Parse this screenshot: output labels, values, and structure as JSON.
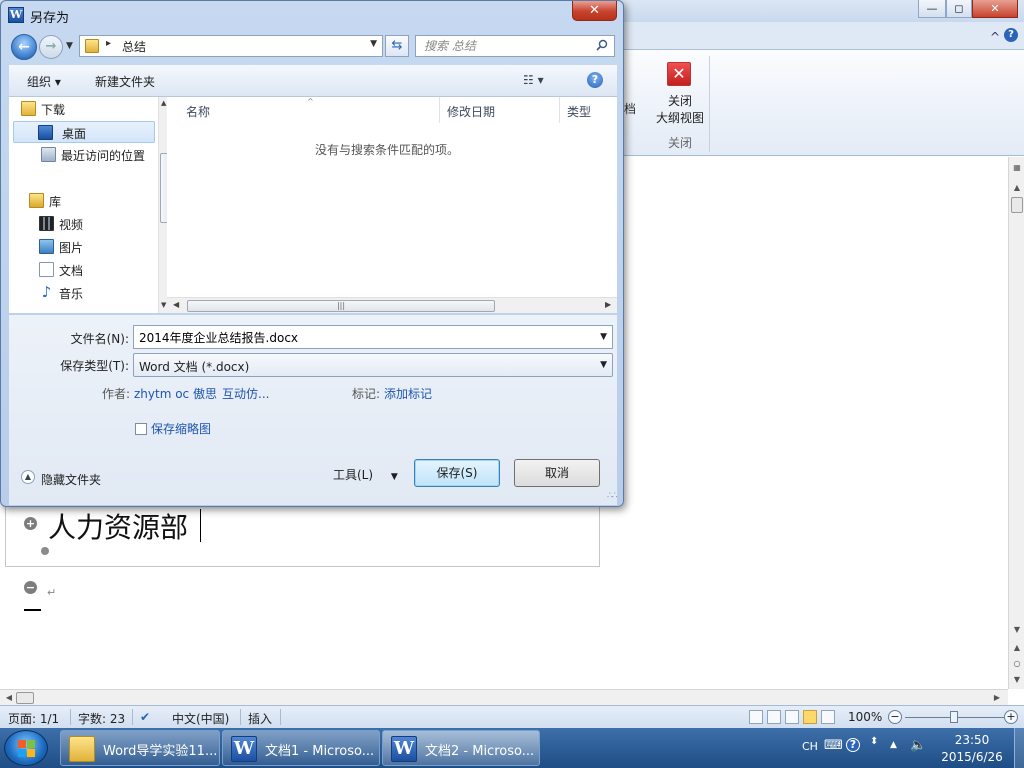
{
  "word": {
    "window_controls": {
      "minimize": "—",
      "maximize": "◻",
      "close": "✕"
    },
    "ribbon": {
      "partial_label": "档",
      "close_outline_label_line1": "关闭",
      "close_outline_label_line2": "大纲视图",
      "close_group_label": "关闭",
      "collapse_ribbon": "^",
      "help": "?"
    },
    "document": {
      "heading": "人力资源部",
      "expand_symbol": "+",
      "collapse_symbol": "−",
      "paragraph_mark": "↵"
    },
    "status": {
      "page": "页面: 1/1",
      "words": "字数: 23",
      "language": "中文(中国)",
      "insert_mode": "插入",
      "zoom": "100%",
      "zoom_level_percent": 100,
      "zoom_out": "−",
      "zoom_in": "+"
    }
  },
  "dialog": {
    "title": "另存为",
    "close_symbol": "✕",
    "address": {
      "path": "总结",
      "separator": "▸"
    },
    "search_placeholder": "搜索 总结",
    "toolbar": {
      "organize": "组织 ▾",
      "new_folder": "新建文件夹",
      "view": "☷ ▾",
      "help": "?"
    },
    "nav_items": [
      {
        "label": "下载",
        "icon": "download-folder-icon"
      },
      {
        "label": "桌面",
        "icon": "desktop-icon"
      },
      {
        "label": "最近访问的位置",
        "icon": "recent-places-icon"
      },
      {
        "label": "库",
        "icon": "library-icon"
      },
      {
        "label": "视频",
        "icon": "video-icon"
      },
      {
        "label": "图片",
        "icon": "pictures-icon"
      },
      {
        "label": "文档",
        "icon": "documents-icon"
      },
      {
        "label": "音乐",
        "icon": "music-icon"
      }
    ],
    "columns": [
      "名称",
      "修改日期",
      "类型"
    ],
    "empty_message": "没有与搜索条件匹配的项。",
    "form": {
      "filename_label": "文件名(N):",
      "filename_value": "2014年度企业总结报告.docx",
      "filetype_label": "保存类型(T):",
      "filetype_value": "Word 文档 (*.docx)",
      "author_label": "作者:",
      "author_value": "zhytm oc 傲思",
      "author_more": "互动仿...",
      "tags_label": "标记:",
      "tags_value": "添加标记",
      "thumbnail_label": "保存缩略图",
      "hide_folders": "隐藏文件夹",
      "tools": "工具(L)",
      "save": "保存(S)",
      "cancel": "取消"
    }
  },
  "taskbar": {
    "tasks": [
      {
        "label": "Word导学实验11...",
        "icon": "folder-icon"
      },
      {
        "label": "文档1 - Microso...",
        "icon": "word-icon"
      },
      {
        "label": "文档2 - Microso...",
        "icon": "word-icon"
      }
    ],
    "tray": {
      "language": "CH",
      "help": "?"
    },
    "time": "23:50",
    "date": "2015/6/26"
  },
  "colors": {
    "dialog_frame": "#c6d9f1",
    "link_blue": "#1f56b0",
    "close_red": "#c7432e",
    "taskbar": "#2a5a94"
  }
}
